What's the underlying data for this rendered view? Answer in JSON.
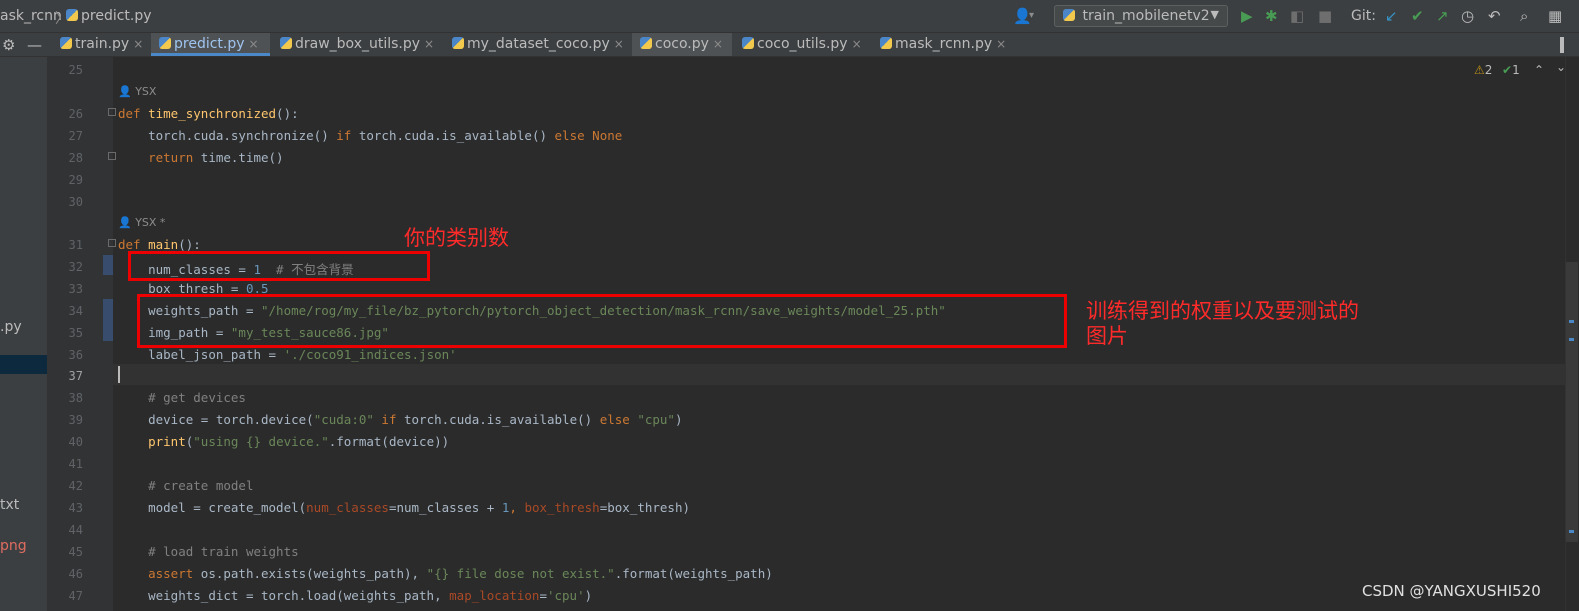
{
  "breadcrumb": {
    "project": "ask_rcnn",
    "file": "predict.py"
  },
  "toolbar": {
    "run_config": "train_mobilenetv2",
    "git_label": "Git:"
  },
  "tabs": [
    "train.py",
    "predict.py",
    "draw_box_utils.py",
    "my_dataset_coco.py",
    "coco.py",
    "coco_utils.py",
    "mask_rcnn.py"
  ],
  "active_tab": "predict.py",
  "left_panel": {
    "items": [
      ".py",
      "txt",
      "png"
    ]
  },
  "inspections": {
    "warnings": "2",
    "ok": "1"
  },
  "author_hints": [
    "YSX",
    "YSX *"
  ],
  "line_numbers": [
    "25",
    "26",
    "27",
    "28",
    "29",
    "30",
    "31",
    "32",
    "33",
    "34",
    "35",
    "36",
    "37",
    "38",
    "39",
    "40",
    "41",
    "42",
    "43",
    "44",
    "45",
    "46",
    "47"
  ],
  "current_line": "37",
  "code": {
    "l26": {
      "kw": "def",
      "name": "time_synchronized",
      "rest": "():"
    },
    "l27": {
      "a": "torch.cuda.synchronize() ",
      "if": "if",
      "b": " torch.cuda.is_available() ",
      "else": "else",
      "none": "None"
    },
    "l28": {
      "kw": "return",
      "rest": " time.time()"
    },
    "l31": {
      "kw": "def",
      "name": "main",
      "rest": "():"
    },
    "l32": {
      "a": "num_classes = ",
      "num": "1",
      "cmt": "  # 不包含背景"
    },
    "l33": {
      "a": "box_thresh = ",
      "num": "0.5"
    },
    "l34": {
      "a": "weights_path = ",
      "str": "\"/home/rog/my_file/bz_pytorch/pytorch_object_detection/mask_rcnn/save_weights/model_25.pth\""
    },
    "l35": {
      "a": "img_path = ",
      "str": "\"my_test_sauce86.jpg\""
    },
    "l36": {
      "a": "label_json_path = ",
      "str": "'./coco91_indices.json'"
    },
    "l38": {
      "cmt": "# get devices"
    },
    "l39": {
      "a": "device = torch.device(",
      "s1": "\"cuda:0\"",
      "if": " if",
      "b": " torch.cuda.is_available() ",
      "else": "else",
      "s2": " \"cpu\"",
      "c": ")"
    },
    "l40": {
      "fn": "print",
      "a": "(",
      "str": "\"using {} device.\"",
      "b": ".format(device))"
    },
    "l42": {
      "cmt": "# create model"
    },
    "l43": {
      "a": "model = create_model(",
      "p1": "num_classes",
      "b": "=num_classes + ",
      "num": "1",
      "c": ", ",
      "p2": "box_thresh",
      "d": "=box_thresh)"
    },
    "l45": {
      "cmt": "# load train weights"
    },
    "l46": {
      "kw": "assert",
      "a": " os.path.exists(weights_path), ",
      "str": "\"{} file dose not exist.\"",
      "b": ".format(weights_path)"
    },
    "l47": {
      "a": "weights_dict = torch.load(weights_path, ",
      "p": "map_location",
      "b": "=",
      "str": "'cpu'",
      "c": ")"
    }
  },
  "annotations": {
    "num_classes_note": "你的类别数",
    "weights_note_1": "训练得到的权重以及要测试的",
    "weights_note_2": "图片"
  },
  "watermark": "CSDN @YANGXUSHI520",
  "colors": {
    "keyword": "#cc7832",
    "function": "#ffc66d",
    "string": "#6a8759",
    "number": "#6897bb",
    "comment": "#808080",
    "annotation": "#ee0000"
  }
}
